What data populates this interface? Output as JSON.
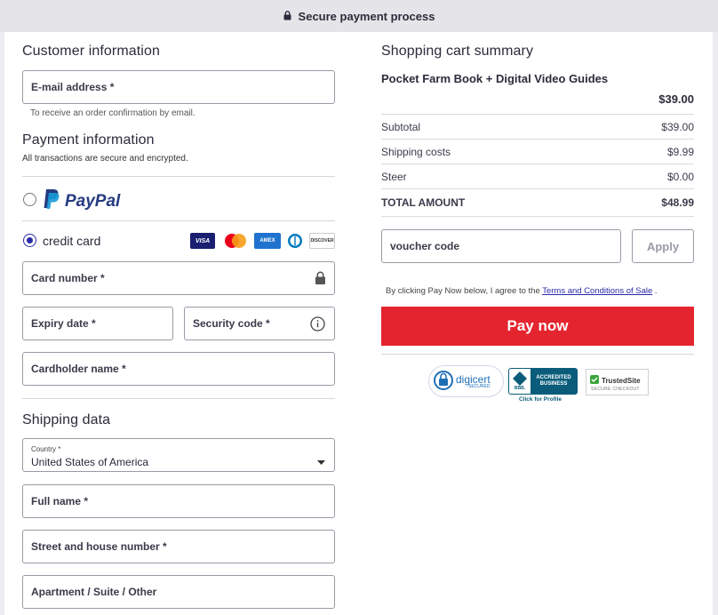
{
  "topbar": {
    "title": "Secure payment process"
  },
  "customer": {
    "heading": "Customer information",
    "email_label": "E-mail address *",
    "email_hint": "To receive an order confirmation by email."
  },
  "payment": {
    "heading": "Payment information",
    "subheading": "All transactions are secure and encrypted.",
    "paypal_label": "PayPal",
    "credit_label": "credit card",
    "card_brands": [
      "VISA",
      "mastercard",
      "AMEX",
      "diners",
      "DISCOVER"
    ],
    "card_number_label": "Card number *",
    "expiry_label": "Expiry date *",
    "security_label": "Security code *",
    "cardholder_label": "Cardholder name *"
  },
  "shipping": {
    "heading": "Shipping data",
    "country_caption": "Country *",
    "country_value": "United States of America",
    "fullname_label": "Full name *",
    "street_label": "Street and house number *",
    "apt_label": "Apartment / Suite / Other"
  },
  "cart": {
    "heading": "Shopping cart summary",
    "product_name": "Pocket Farm Book + Digital Video Guides",
    "product_price": "$39.00",
    "rows": [
      {
        "label": "Subtotal",
        "value": "$39.00"
      },
      {
        "label": "Shipping costs",
        "value": "$9.99"
      },
      {
        "label": "Steer",
        "value": "$0.00"
      }
    ],
    "total_label": "TOTAL AMOUNT",
    "total_value": "$48.99",
    "voucher_label": "voucher code",
    "apply_label": "Apply",
    "terms_prefix": "By clicking Pay Now below, I agree to the ",
    "terms_link": "Terms and Conditions of Sale",
    "terms_suffix": " .",
    "pay_label": "Pay now"
  },
  "badges": {
    "digicert": "digicert",
    "digicert_sub": "SECURED",
    "bbb_line1": "ACCREDITED",
    "bbb_line2": "BUSINESS",
    "bbb_logo": "BBB.",
    "bbb_caption": "Click for Profile",
    "trusted": "TrustedSite",
    "trusted_sub": "SECURE CHECKOUT"
  },
  "colors": {
    "accent": "#2a2aa8",
    "pay": "#e4252f",
    "paypal_dark": "#253b80",
    "paypal_light": "#179bd7"
  }
}
